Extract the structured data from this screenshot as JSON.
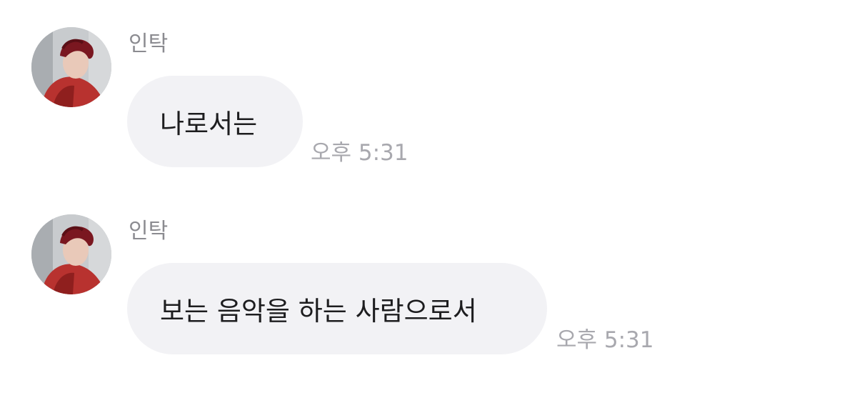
{
  "messages": [
    {
      "sender": "인탁",
      "text": "나로서는",
      "time": "오후 5:31"
    },
    {
      "sender": "인탁",
      "text": "보는 음악을 하는 사람으로서",
      "time": "오후 5:31"
    }
  ],
  "colors": {
    "bubble": "#f2f2f5",
    "sender": "#8b8b90",
    "timestamp": "#a8a8ae",
    "text": "#1d1d1f"
  }
}
